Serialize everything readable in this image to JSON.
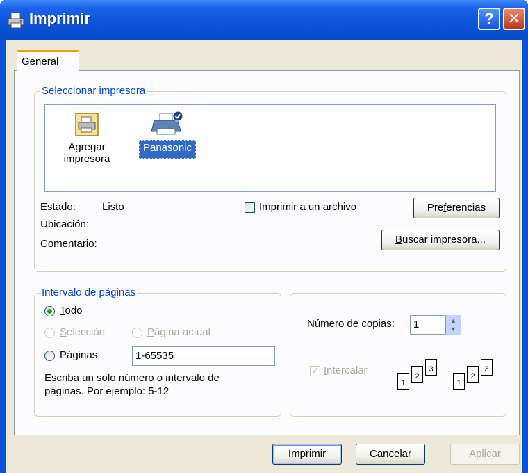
{
  "window": {
    "title": "Imprimir",
    "help_glyph": "?",
    "close_glyph": "✕"
  },
  "tabs": [
    {
      "label": "General"
    }
  ],
  "select_printer": {
    "legend": "Seleccionar impresora",
    "printers": [
      {
        "label_line1": "Agregar",
        "label_line2": "impresora",
        "icon": "add-printer-icon"
      },
      {
        "label": "Panasonic",
        "icon": "printer-icon",
        "selected": true
      }
    ],
    "status_label": "Estado:",
    "status_value": "Listo",
    "location_label": "Ubicación:",
    "comment_label": "Comentario:",
    "print_to_file": {
      "pre": "Imprimir a un ",
      "accel": "a",
      "post": "rchivo",
      "checked": false
    },
    "preferences_button": {
      "pre": "Pre",
      "accel": "f",
      "post": "erencias"
    },
    "find_printer_button": {
      "pre": "",
      "accel": "B",
      "post": "uscar impresora..."
    }
  },
  "page_range": {
    "legend": "Intervalo de páginas",
    "all": {
      "accel": "T",
      "post": "odo",
      "selected": true
    },
    "selection": {
      "accel": "S",
      "post": "elección",
      "enabled": false
    },
    "current_page": {
      "accel": "P",
      "post": "ágina actual",
      "enabled": false
    },
    "pages": {
      "label": "Páginas:",
      "value": "1-65535"
    },
    "hint_line1": "Escriba un solo número o intervalo de",
    "hint_line2": "páginas. Por ejemplo: 5-12"
  },
  "copies": {
    "label_pre": "Número de c",
    "label_accel": "o",
    "label_post": "pias:",
    "value": "1",
    "collate": {
      "accel": "I",
      "post": "ntercalar",
      "checked": true,
      "enabled": false
    },
    "collate_pages": [
      "1",
      "2",
      "3"
    ]
  },
  "buttons": {
    "print": {
      "pre": "",
      "accel": "I",
      "post": "mprimir"
    },
    "cancel": {
      "label": "Cancelar"
    },
    "apply": {
      "pre": "Apli",
      "accel": "c",
      "post": "ar",
      "enabled": false
    }
  },
  "colors": {
    "titlebar": "#0a52d6",
    "legend_text": "#0046d5",
    "selection": "#316ac5",
    "dialog_bg": "#ece9d8"
  }
}
